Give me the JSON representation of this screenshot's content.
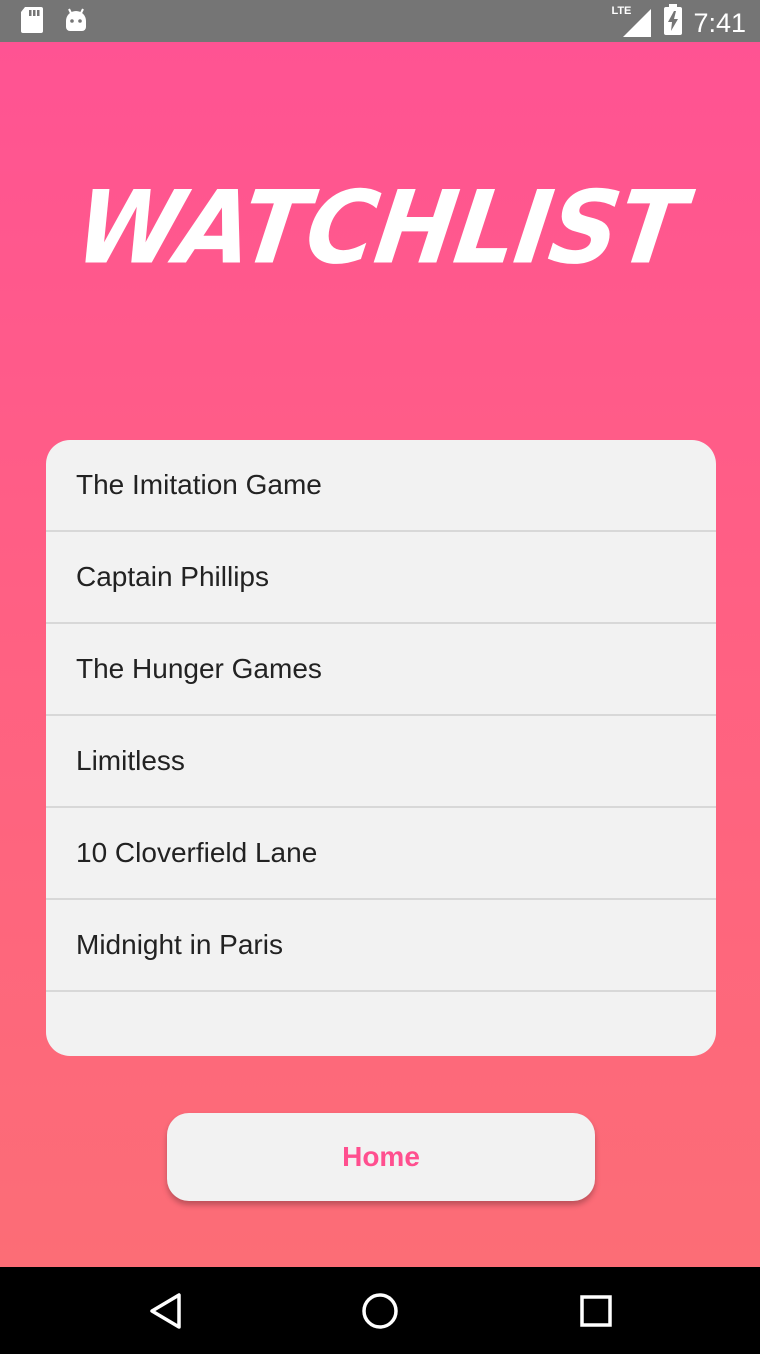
{
  "status_bar": {
    "time": "7:41",
    "network": "LTE",
    "icons": [
      "sd-card-icon",
      "android-icon",
      "signal-icon",
      "battery-charging-icon"
    ]
  },
  "header": {
    "title": "WATCHLIST"
  },
  "watchlist": {
    "items": [
      {
        "label": "The Imitation Game"
      },
      {
        "label": "Captain Phillips"
      },
      {
        "label": "The Hunger Games"
      },
      {
        "label": "Limitless"
      },
      {
        "label": "10 Cloverfield Lane"
      },
      {
        "label": "Midnight in Paris"
      }
    ]
  },
  "actions": {
    "home_label": "Home"
  },
  "nav_bar": {
    "icons": [
      "back-icon",
      "home-circle-icon",
      "recents-icon"
    ]
  },
  "colors": {
    "gradient_top": "#ff5393",
    "gradient_bottom": "#fc6d76",
    "card_bg": "#f2f2f2",
    "accent": "#ff4f8f"
  }
}
